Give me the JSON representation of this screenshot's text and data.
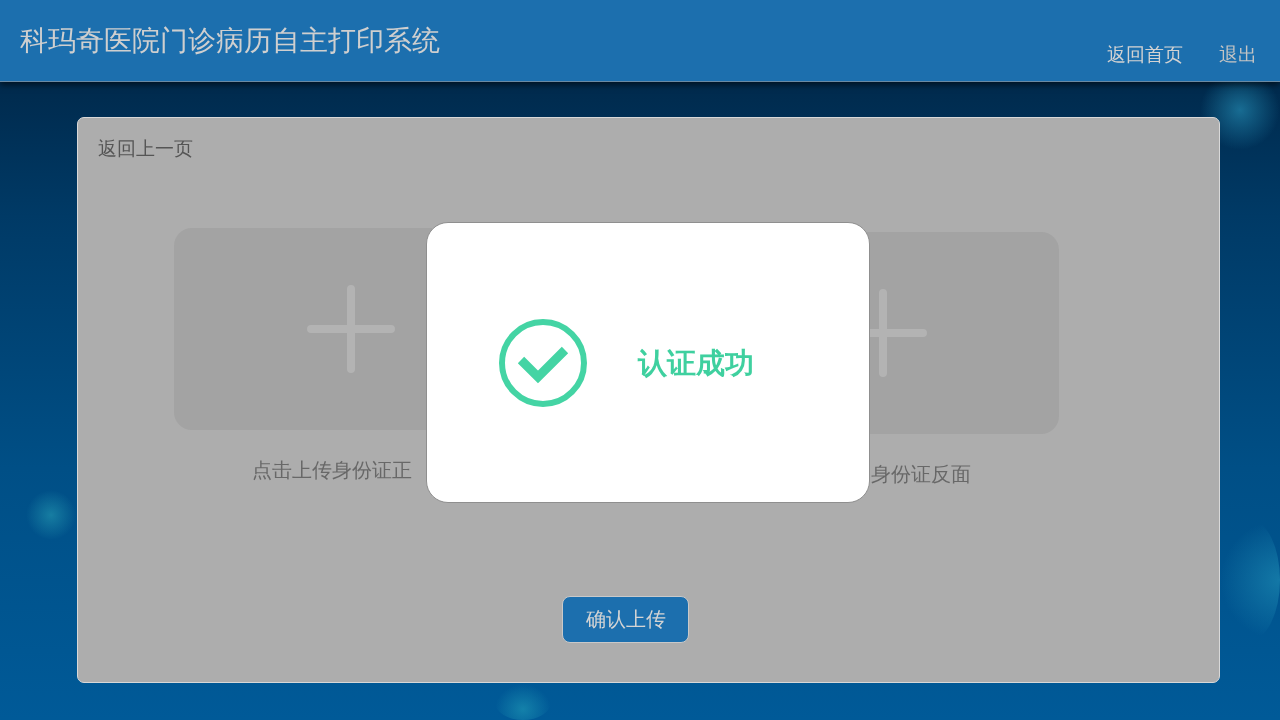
{
  "header": {
    "title": "科玛奇医院门诊病历自主打印系统",
    "nav": [
      "返回首页",
      "退出"
    ]
  },
  "card": {
    "back_link": "返回上一页",
    "uploads": [
      {
        "caption": "点击上传身份证正"
      },
      {
        "caption": "身份证反面"
      }
    ],
    "confirm_button": "确认上传"
  },
  "dialog": {
    "message": "认证成功"
  }
}
